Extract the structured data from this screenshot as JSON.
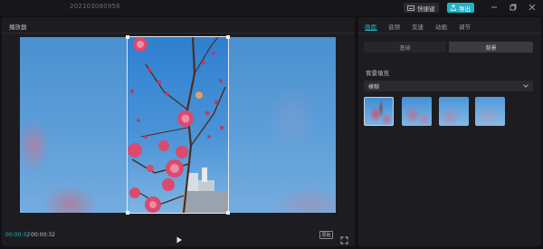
{
  "titlebar": {
    "project_name": "202103080956",
    "shortcut_label": "快捷键",
    "export_label": "导出",
    "colors": {
      "accent": "#1fb4c6"
    }
  },
  "player": {
    "title": "播放器",
    "time_current": "00:00:32",
    "time_separator": "/",
    "time_total": "00:00:32",
    "ratio_label": "原始",
    "icons": [
      "play-icon",
      "fullscreen-icon"
    ]
  },
  "props": {
    "tabs": [
      {
        "label": "画面",
        "active": true
      },
      {
        "label": "音频",
        "active": false
      },
      {
        "label": "变速",
        "active": false
      },
      {
        "label": "动画",
        "active": false
      },
      {
        "label": "调节",
        "active": false
      }
    ],
    "segments": [
      {
        "label": "基础",
        "active": false
      },
      {
        "label": "背景",
        "active": true
      }
    ],
    "fill_label": "背景填充",
    "fill_select": {
      "value": "模糊"
    },
    "blur_options_count": 4,
    "selected_blur_index": 0
  }
}
